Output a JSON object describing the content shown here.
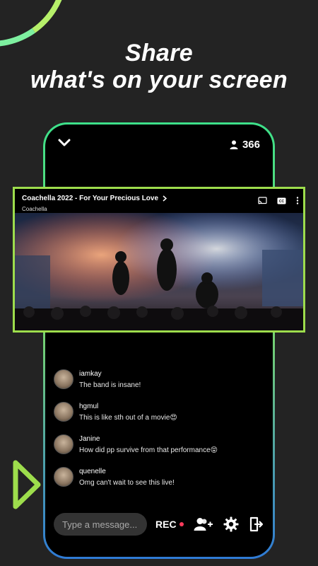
{
  "headline": {
    "line1": "Share",
    "line2": "what's on your screen"
  },
  "room": {
    "viewer_count": "366"
  },
  "video": {
    "title": "Coachella 2022 - For Your Precious Love",
    "channel": "Coachella"
  },
  "chat": {
    "messages": [
      {
        "user": "iamkay",
        "text": "The band is insane!"
      },
      {
        "user": "hgmul",
        "text": "This is like sth out of a movie😍"
      },
      {
        "user": "Janine",
        "text": "How did pp survive from that performance😝"
      },
      {
        "user": "quenelle",
        "text": "Omg can't wait to see this live!"
      }
    ]
  },
  "bottom_bar": {
    "input_placeholder": "Type a message...",
    "rec_label": "REC"
  },
  "colors": {
    "accent_green": "#9ddd4c",
    "rec_red": "#ff3b5c",
    "background": "#232323"
  },
  "icons": [
    "chevron-down-icon",
    "user-icon",
    "cast-icon",
    "captions-icon",
    "more-vertical-icon",
    "add-user-icon",
    "gear-icon",
    "exit-icon"
  ]
}
